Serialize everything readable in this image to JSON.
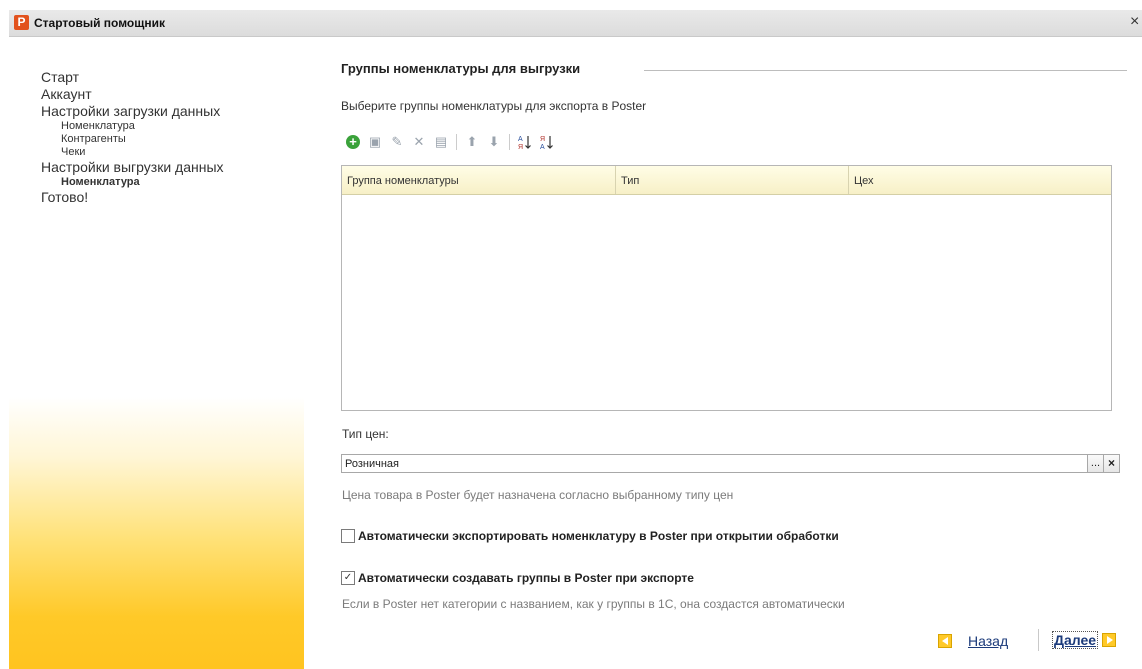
{
  "window": {
    "title": "Стартовый помощник",
    "logo_letter": "P",
    "close_glyph": "×"
  },
  "sidebar": {
    "items": [
      {
        "label": "Старт",
        "level": 0
      },
      {
        "label": "Аккаунт",
        "level": 0
      },
      {
        "label": "Настройки загрузки данных",
        "level": 0
      },
      {
        "label": "Номенклатура",
        "level": 1
      },
      {
        "label": "Контрагенты",
        "level": 1
      },
      {
        "label": "Чеки",
        "level": 1
      },
      {
        "label": "Настройки выгрузки данных",
        "level": 0
      },
      {
        "label": "Номенклатура",
        "level": 1,
        "active": true
      },
      {
        "label": "Готово!",
        "level": 0
      }
    ]
  },
  "main": {
    "section_title": "Группы номенклатуры для выгрузки",
    "description": "Выберите группы номенклатуры для экспорта в Poster",
    "toolbar": {
      "icons": [
        "add-icon",
        "copy-icon",
        "edit-icon",
        "delete-icon",
        "save-icon",
        "move-up-icon",
        "move-down-icon",
        "sort-asc-icon",
        "sort-desc-icon"
      ]
    },
    "table": {
      "columns": [
        "Группа номенклатуры",
        "Тип",
        "Цех"
      ],
      "rows": []
    },
    "price_type": {
      "label": "Тип цен:",
      "value": "Розничная",
      "select_glyph": "...",
      "clear_glyph": "×",
      "hint": "Цена товара в Poster будет назначена согласно выбранному типу цен"
    },
    "auto_export": {
      "label": "Автоматически экспортировать номенклатуру в Poster при открытии обработки",
      "checked": false
    },
    "auto_groups": {
      "label": "Автоматически создавать группы в Poster при экспорте",
      "checked": true,
      "hint": "Если в Poster нет категории с названием, как у группы в 1С, она создастся автоматически"
    }
  },
  "footer": {
    "back_label": "Назад",
    "next_label": "Далее"
  },
  "colors": {
    "accent_yellow": "#ffc928",
    "link_blue": "#1b3a7a",
    "logo_orange": "#e2521d"
  }
}
